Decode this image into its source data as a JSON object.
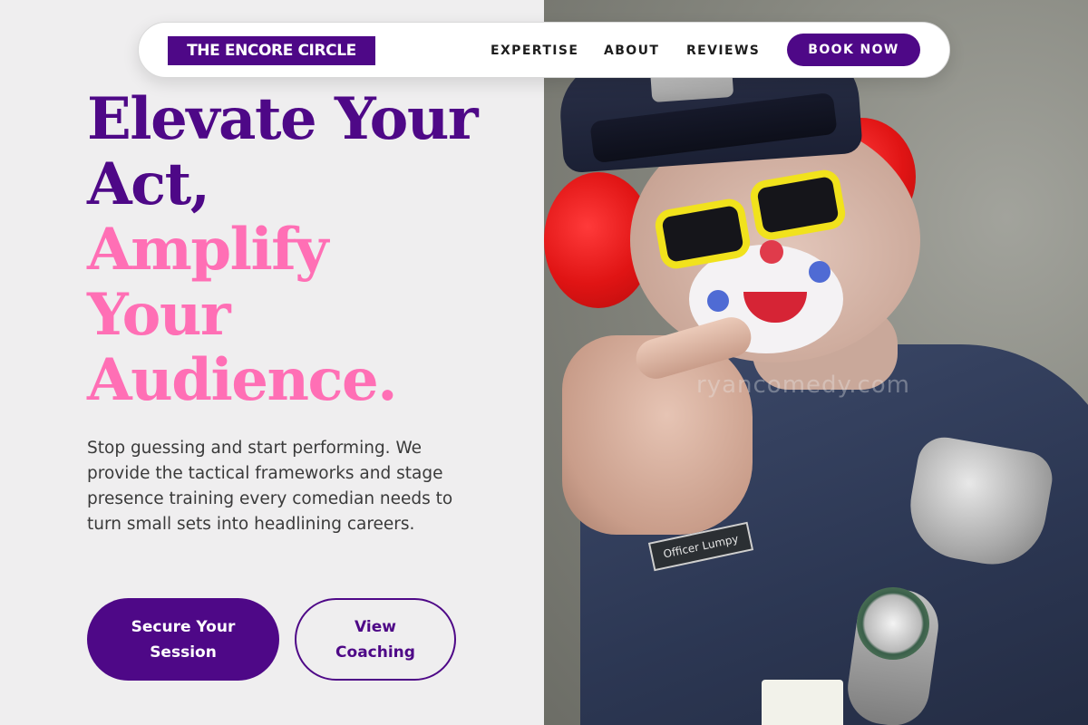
{
  "brand": {
    "logo_text": "THE ENCORE CIRCLE",
    "primary_color": "#4e0887",
    "accent_color": "#ff6fb5"
  },
  "nav": {
    "links": [
      "EXPERTISE",
      "ABOUT",
      "REVIEWS"
    ],
    "cta_label": "BOOK NOW"
  },
  "hero": {
    "headline_line1": "Elevate Your",
    "headline_line2": "Act,",
    "headline_line3": "Amplify",
    "headline_line4": "Your",
    "headline_line5": "Audience.",
    "lede": "Stop guessing and start performing. We provide the tactical frameworks and stage presence training every comedian needs to turn small sets into headlining careers.",
    "primary_button": "Secure Your Session",
    "secondary_button": "View Coaching"
  },
  "photo": {
    "nametag_text": "Officer Lumpy",
    "watermark": "ryancomedy.com"
  }
}
